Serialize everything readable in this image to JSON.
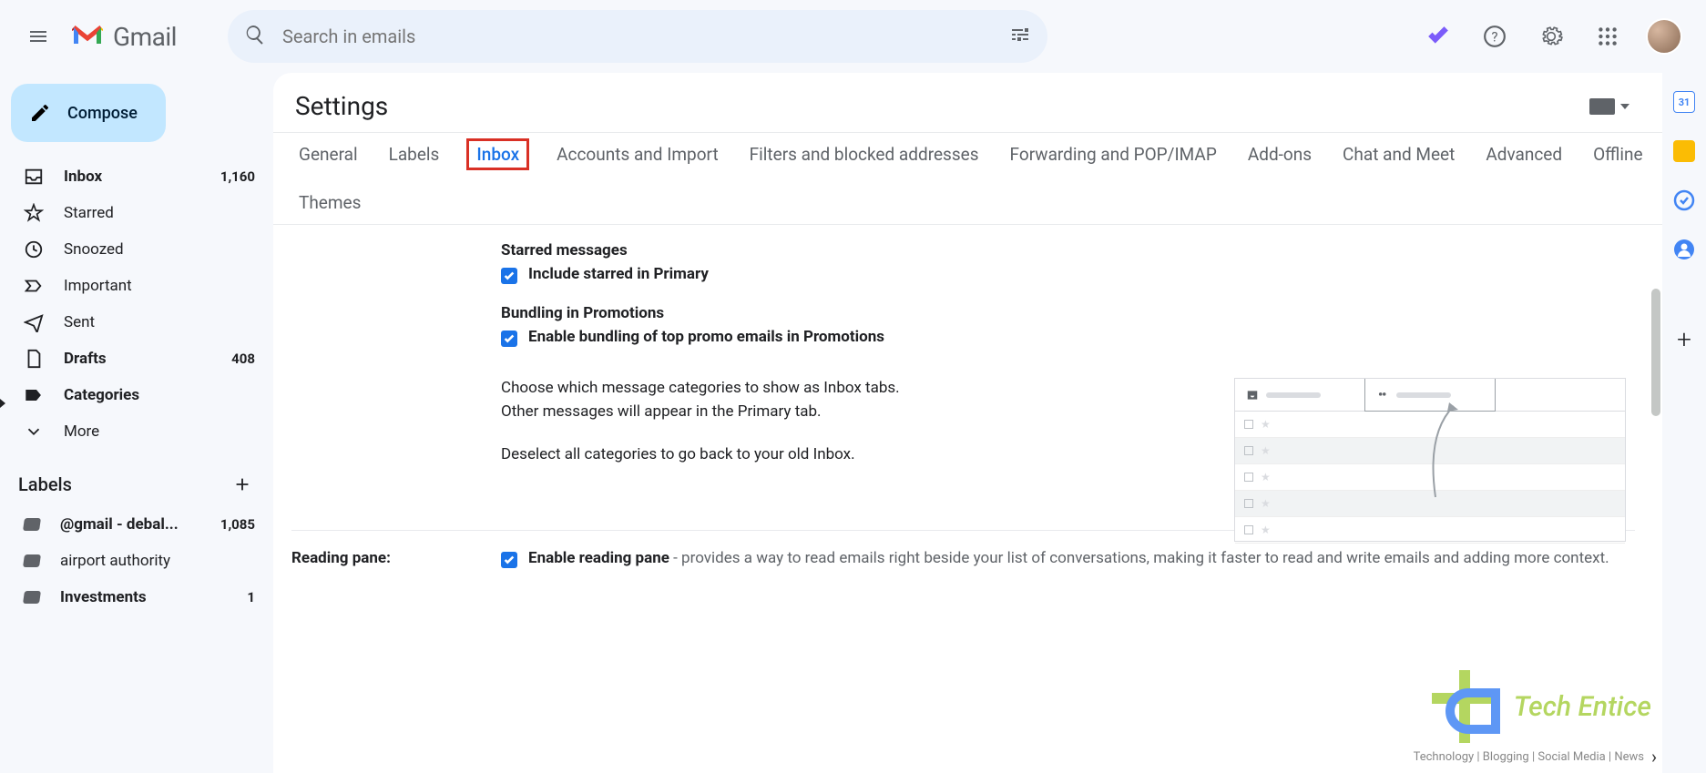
{
  "header": {
    "app_name": "Gmail",
    "search_placeholder": "Search in emails"
  },
  "compose_label": "Compose",
  "nav": [
    {
      "label": "Inbox",
      "count": "1,160",
      "bold": true
    },
    {
      "label": "Starred",
      "count": "",
      "bold": false
    },
    {
      "label": "Snoozed",
      "count": "",
      "bold": false
    },
    {
      "label": "Important",
      "count": "",
      "bold": false
    },
    {
      "label": "Sent",
      "count": "",
      "bold": false
    },
    {
      "label": "Drafts",
      "count": "408",
      "bold": true
    },
    {
      "label": "Categories",
      "count": "",
      "bold": true
    },
    {
      "label": "More",
      "count": "",
      "bold": false
    }
  ],
  "labels_header": "Labels",
  "labels": [
    {
      "label": "@gmail - debal...",
      "count": "1,085",
      "bold": true
    },
    {
      "label": "airport authority",
      "count": "",
      "bold": false
    },
    {
      "label": "Investments",
      "count": "1",
      "bold": true
    }
  ],
  "settings_title": "Settings",
  "tabs": [
    "General",
    "Labels",
    "Inbox",
    "Accounts and Import",
    "Filters and blocked addresses",
    "Forwarding and POP/IMAP",
    "Add-ons",
    "Chat and Meet",
    "Advanced",
    "Offline",
    "Themes"
  ],
  "active_tab": "Inbox",
  "sections": {
    "starred_title": "Starred messages",
    "starred_check": "Include starred in Primary",
    "bundling_title": "Bundling in Promotions",
    "bundling_check": "Enable bundling of top promo emails in Promotions",
    "categories_para1": "Choose which message categories to show as Inbox tabs. Other messages will appear in the Primary tab.",
    "categories_para2": "Deselect all categories to go back to your old Inbox.",
    "reading_label": "Reading pane:",
    "reading_check": "Enable reading pane",
    "reading_desc": " - provides a way to read emails right beside your list of conversations, making it faster to read and write emails and adding more context."
  },
  "watermark": {
    "text": "Tech Entice",
    "tagline": "Technology | Blogging | Social Media | News"
  }
}
